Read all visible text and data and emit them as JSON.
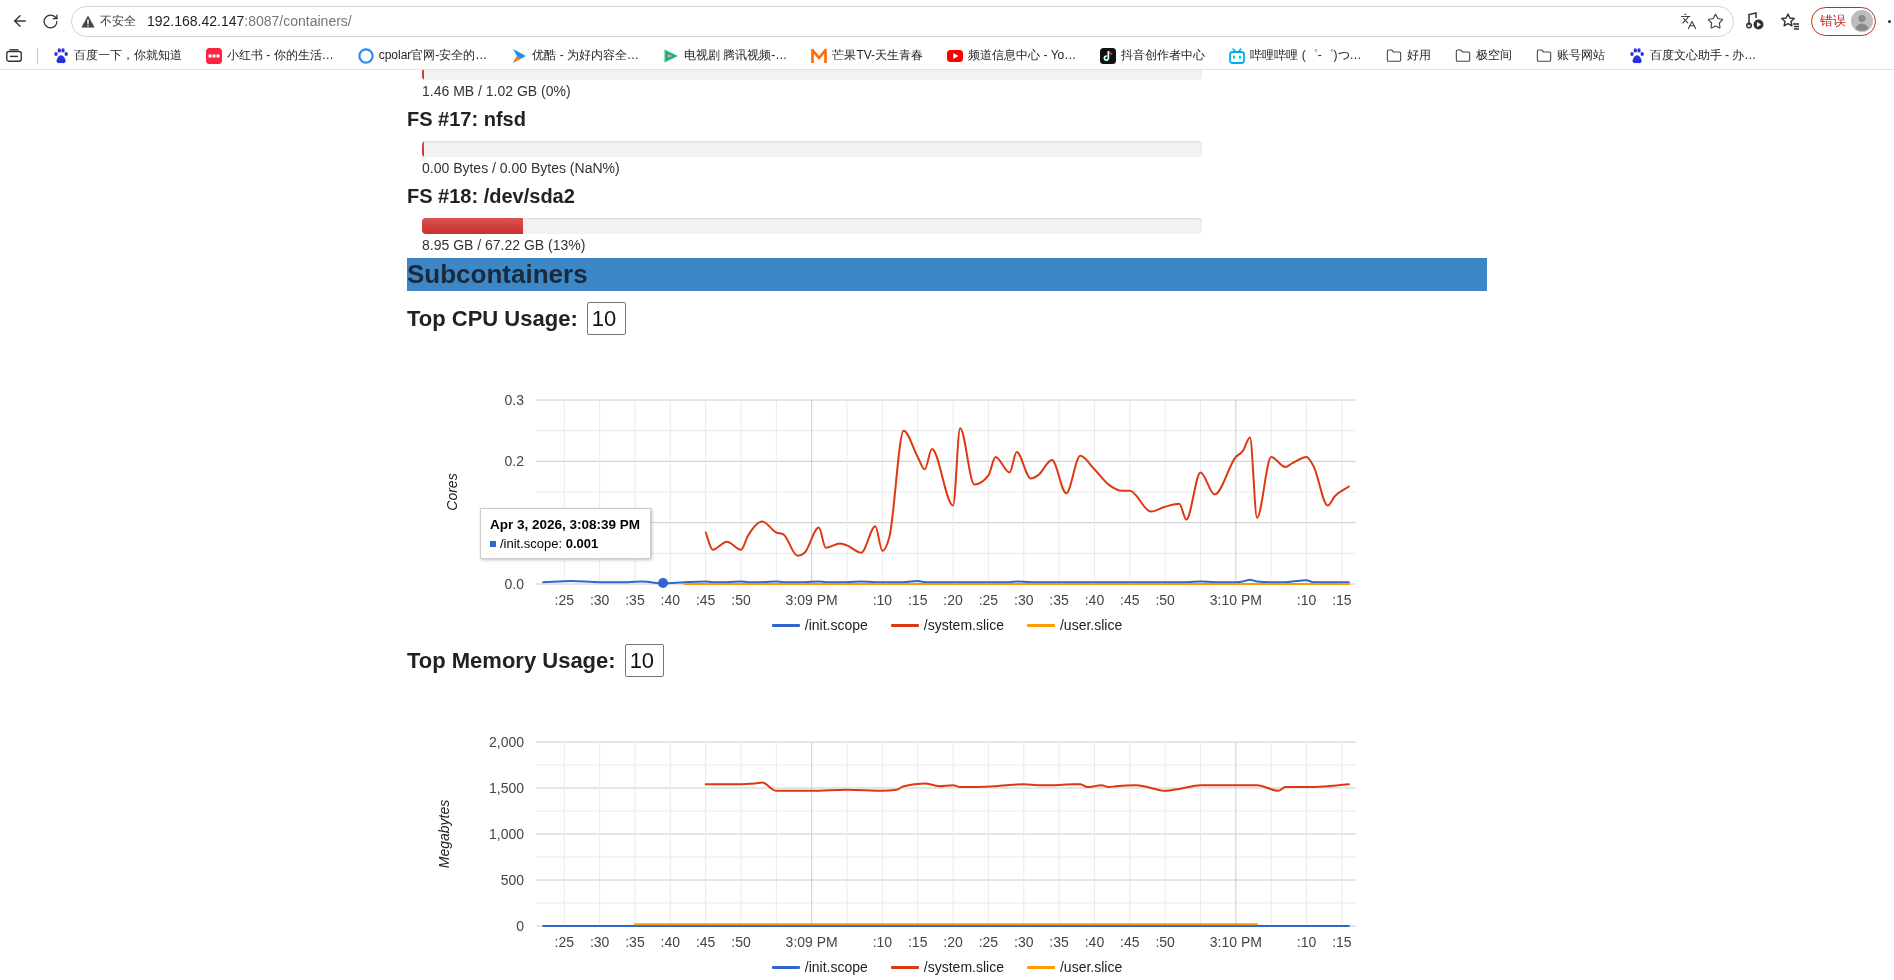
{
  "browser": {
    "address_bar": {
      "security_label": "不安全",
      "host": "192.168.42.147",
      "path": ":8087/containers/"
    },
    "profile_label": "错误",
    "bookmarks": [
      {
        "kind": "paw",
        "title": "百度一下，你就知道"
      },
      {
        "kind": "tile",
        "title": "小红书 - 你的生活…"
      },
      {
        "kind": "ring",
        "title": "cpolar官网-安全的…"
      },
      {
        "kind": "arrow",
        "title": "优酷 - 为好内容全…"
      },
      {
        "kind": "triangle",
        "title": "电视剧 腾讯视频-…"
      },
      {
        "kind": "mlogo",
        "title": "芒果TV-天生青春"
      },
      {
        "kind": "video",
        "title": "频道信息中心 - Yo…"
      },
      {
        "kind": "note",
        "title": "抖音创作者中心"
      },
      {
        "kind": "tv",
        "title": "哔哩哔哩 (゜-゜)つ…"
      },
      {
        "kind": "folder",
        "title": "好用"
      },
      {
        "kind": "folder",
        "title": "极空间"
      },
      {
        "kind": "folder",
        "title": "账号网站"
      },
      {
        "kind": "paw",
        "title": "百度文心助手 - 办…"
      }
    ]
  },
  "filesystems": [
    {
      "usage": "1.46 MB / 1.02 GB (0%)",
      "level": 0
    },
    {
      "name": "FS #17: nfsd",
      "usage": "0.00 Bytes / 0.00 Bytes (NaN%)",
      "level": 0
    },
    {
      "name": "FS #18: /dev/sda2",
      "usage": "8.95 GB / 67.22 GB (13%)",
      "level": 0.13
    }
  ],
  "subcontainers": {
    "title": "Subcontainers",
    "cpu": {
      "label": "Top CPU Usage:",
      "value": "10",
      "chart_data": {
        "type": "line",
        "ylabel": "Cores",
        "grid": true,
        "legend": "bottom",
        "x": [
          "2026-04-03T15:08:22",
          "2026-04-03T15:08:26",
          "2026-04-03T15:08:30",
          "2026-04-03T15:08:34",
          "2026-04-03T15:08:36",
          "2026-04-03T15:08:39",
          "2026-04-03T15:08:42",
          "2026-04-03T15:08:45",
          "2026-04-03T15:08:46",
          "2026-04-03T15:08:48",
          "2026-04-03T15:08:50",
          "2026-04-03T15:08:51",
          "2026-04-03T15:08:53",
          "2026-04-03T15:08:55",
          "2026-04-03T15:08:56",
          "2026-04-03T15:08:58",
          "2026-04-03T15:08:59",
          "2026-04-03T15:09:01",
          "2026-04-03T15:09:02",
          "2026-04-03T15:09:04",
          "2026-04-03T15:09:05",
          "2026-04-03T15:09:07",
          "2026-04-03T15:09:09",
          "2026-04-03T15:09:10",
          "2026-04-03T15:09:11",
          "2026-04-03T15:09:13",
          "2026-04-03T15:09:15",
          "2026-04-03T15:09:16",
          "2026-04-03T15:09:17",
          "2026-04-03T15:09:20",
          "2026-04-03T15:09:21",
          "2026-04-03T15:09:23",
          "2026-04-03T15:09:25",
          "2026-04-03T15:09:26",
          "2026-04-03T15:09:28",
          "2026-04-03T15:09:29",
          "2026-04-03T15:09:31",
          "2026-04-03T15:09:32",
          "2026-04-03T15:09:34",
          "2026-04-03T15:09:36",
          "2026-04-03T15:09:38",
          "2026-04-03T15:09:40",
          "2026-04-03T15:09:42",
          "2026-04-03T15:09:44",
          "2026-04-03T15:09:45",
          "2026-04-03T15:09:48",
          "2026-04-03T15:09:50",
          "2026-04-03T15:09:52",
          "2026-04-03T15:09:53",
          "2026-04-03T15:09:55",
          "2026-04-03T15:09:57",
          "2026-04-03T15:10:00",
          "2026-04-03T15:10:01",
          "2026-04-03T15:10:02",
          "2026-04-03T15:10:03",
          "2026-04-03T15:10:05",
          "2026-04-03T15:10:07",
          "2026-04-03T15:10:08",
          "2026-04-03T15:10:10",
          "2026-04-03T15:10:11",
          "2026-04-03T15:10:13",
          "2026-04-03T15:10:14",
          "2026-04-03T15:10:16"
        ],
        "series": [
          {
            "name": "/init.scope",
            "color": "#3366cc",
            "values": [
              0.003,
              0.005,
              0.003,
              0.003,
              0.004,
              0.001,
              0.003,
              0.004,
              0.003,
              0.003,
              0.004,
              0.003,
              0.003,
              0.004,
              0.003,
              0.003,
              0.003,
              0.004,
              0.003,
              0.003,
              0.003,
              0.004,
              0.003,
              0.003,
              0.003,
              0.003,
              0.005,
              0.003,
              0.003,
              0.003,
              0.003,
              0.003,
              0.003,
              0.003,
              0.003,
              0.004,
              0.003,
              0.003,
              0.003,
              0.003,
              0.003,
              0.003,
              0.003,
              0.003,
              0.003,
              0.003,
              0.003,
              0.003,
              0.003,
              0.004,
              0.003,
              0.003,
              0.004,
              0.007,
              0.004,
              0.003,
              0.003,
              0.004,
              0.006,
              0.003,
              0.003,
              0.003,
              0.003
            ]
          },
          {
            "name": "/system.slice",
            "color": "#dc3912",
            "values": [
              null,
              null,
              null,
              null,
              null,
              null,
              null,
              0.084,
              0.056,
              0.069,
              0.056,
              0.079,
              0.102,
              0.084,
              0.081,
              0.046,
              0.051,
              0.092,
              0.059,
              0.066,
              0.063,
              0.051,
              0.094,
              0.054,
              0.077,
              0.25,
              0.207,
              0.187,
              0.22,
              0.128,
              0.254,
              0.162,
              0.177,
              0.207,
              0.182,
              0.215,
              0.172,
              0.177,
              0.202,
              0.148,
              0.209,
              0.187,
              0.162,
              0.152,
              0.152,
              0.118,
              0.126,
              0.131,
              0.105,
              0.182,
              0.146,
              0.207,
              0.217,
              0.239,
              0.108,
              0.207,
              0.191,
              0.197,
              0.207,
              0.192,
              0.128,
              0.143,
              0.159
            ]
          },
          {
            "name": "/user.slice",
            "color": "#ff9900",
            "values": [
              null,
              null,
              null,
              null,
              null,
              null,
              0,
              0,
              0,
              0,
              0,
              0,
              0,
              0,
              0,
              0,
              0,
              0,
              0,
              0,
              0,
              0,
              0,
              0,
              0,
              0,
              0,
              0,
              0,
              0,
              0,
              0,
              0,
              0,
              0,
              0,
              0,
              0,
              0,
              0,
              0,
              0,
              0,
              0,
              0,
              0,
              0,
              0,
              0,
              0,
              0,
              0,
              0,
              0,
              0,
              0,
              0,
              0,
              0,
              0,
              0,
              0,
              0
            ]
          }
        ],
        "xlim": [
          "2026-04-03T15:08:21",
          "2026-04-03T15:10:17"
        ],
        "ylim": [
          0,
          0.3
        ],
        "xticks": [
          {
            "value": "2026-04-03T15:08:25",
            "label": ":25"
          },
          {
            "value": "2026-04-03T15:08:30",
            "label": ":30"
          },
          {
            "value": "2026-04-03T15:08:35",
            "label": ":35"
          },
          {
            "value": "2026-04-03T15:08:40",
            "label": ":40"
          },
          {
            "value": "2026-04-03T15:08:45",
            "label": ":45"
          },
          {
            "value": "2026-04-03T15:08:50",
            "label": ":50"
          },
          {
            "value": "2026-04-03T15:09:00",
            "label": "3:09 PM"
          },
          {
            "value": "2026-04-03T15:09:10",
            "label": ":10"
          },
          {
            "value": "2026-04-03T15:09:15",
            "label": ":15"
          },
          {
            "value": "2026-04-03T15:09:20",
            "label": ":20"
          },
          {
            "value": "2026-04-03T15:09:25",
            "label": ":25"
          },
          {
            "value": "2026-04-03T15:09:30",
            "label": ":30"
          },
          {
            "value": "2026-04-03T15:09:35",
            "label": ":35"
          },
          {
            "value": "2026-04-03T15:09:40",
            "label": ":40"
          },
          {
            "value": "2026-04-03T15:09:45",
            "label": ":45"
          },
          {
            "value": "2026-04-03T15:09:50",
            "label": ":50"
          },
          {
            "value": "2026-04-03T15:10:00",
            "label": "3:10 PM"
          },
          {
            "value": "2026-04-03T15:10:10",
            "label": ":10"
          },
          {
            "value": "2026-04-03T15:10:15",
            "label": ":15"
          }
        ],
        "yticks": [
          {
            "value": 0,
            "label": "0.0"
          },
          {
            "value": 0.2,
            "label": "0.2"
          },
          {
            "value": 0.3,
            "label": "0.3"
          }
        ]
      },
      "tooltip": {
        "title": "Apr 3, 2026, 3:08:39 PM",
        "rows": [
          {
            "text": "/init.scope: **0.001**",
            "color": "#3366cc"
          }
        ]
      }
    },
    "memory": {
      "label": "Top Memory Usage:",
      "value": "10",
      "chart_data": {
        "type": "line",
        "ylabel": "Megabytes",
        "grid": true,
        "legend": "bottom",
        "x": [
          "2026-04-03T15:08:22",
          "2026-04-03T15:08:35",
          "2026-04-03T15:08:40",
          "2026-04-03T15:08:45",
          "2026-04-03T15:08:48",
          "2026-04-03T15:08:52",
          "2026-04-03T15:08:53",
          "2026-04-03T15:08:55",
          "2026-04-03T15:09:00",
          "2026-04-03T15:09:05",
          "2026-04-03T15:09:10",
          "2026-04-03T15:09:12",
          "2026-04-03T15:09:13",
          "2026-04-03T15:09:16",
          "2026-04-03T15:09:18",
          "2026-04-03T15:09:20",
          "2026-04-03T15:09:21",
          "2026-04-03T15:09:26",
          "2026-04-03T15:09:30",
          "2026-04-03T15:09:32",
          "2026-04-03T15:09:34",
          "2026-04-03T15:09:37",
          "2026-04-03T15:09:38",
          "2026-04-03T15:09:39",
          "2026-04-03T15:09:41",
          "2026-04-03T15:09:42",
          "2026-04-03T15:09:43",
          "2026-04-03T15:09:46",
          "2026-04-03T15:09:48",
          "2026-04-03T15:09:50",
          "2026-04-03T15:09:52",
          "2026-04-03T15:09:55",
          "2026-04-03T15:10:00",
          "2026-04-03T15:10:03",
          "2026-04-03T15:10:06",
          "2026-04-03T15:10:07",
          "2026-04-03T15:10:10",
          "2026-04-03T15:10:13",
          "2026-04-03T15:10:16"
        ],
        "series": [
          {
            "name": "/init.scope",
            "color": "#3366cc",
            "values": [
              0,
              0,
              0,
              0,
              0,
              0,
              0,
              0,
              0,
              0,
              0,
              0,
              0,
              0,
              0,
              0,
              0,
              0,
              0,
              0,
              0,
              0,
              0,
              0,
              0,
              0,
              0,
              0,
              0,
              0,
              0,
              0,
              0,
              0,
              0,
              0,
              0,
              0,
              0
            ]
          },
          {
            "name": "/system.slice",
            "color": "#dc3912",
            "values": [
              null,
              null,
              null,
              1540,
              1540,
              1550,
              1560,
              1470,
              1470,
              1480,
              1470,
              1480,
              1520,
              1550,
              1520,
              1530,
              1510,
              1520,
              1540,
              1530,
              1530,
              1540,
              1540,
              1510,
              1530,
              1510,
              1520,
              1530,
              1500,
              1470,
              1490,
              1530,
              1530,
              1530,
              1470,
              1510,
              1510,
              1520,
              1540
            ]
          },
          {
            "name": "/user.slice",
            "color": "#ff9900",
            "values": [
              null,
              20,
              20,
              20,
              20,
              20,
              20,
              20,
              20,
              20,
              20,
              20,
              20,
              20,
              20,
              20,
              20,
              20,
              20,
              20,
              20,
              20,
              20,
              20,
              20,
              20,
              20,
              20,
              20,
              20,
              20,
              20,
              20,
              20,
              null,
              null,
              null,
              null,
              null
            ]
          }
        ],
        "xlim": [
          "2026-04-03T15:08:21",
          "2026-04-03T15:10:17"
        ],
        "ylim": [
          0,
          2000
        ],
        "xticks": [
          {
            "value": "2026-04-03T15:08:25",
            "label": ":25"
          },
          {
            "value": "2026-04-03T15:08:30",
            "label": ":30"
          },
          {
            "value": "2026-04-03T15:08:35",
            "label": ":35"
          },
          {
            "value": "2026-04-03T15:08:40",
            "label": ":40"
          },
          {
            "value": "2026-04-03T15:08:45",
            "label": ":45"
          },
          {
            "value": "2026-04-03T15:08:50",
            "label": ":50"
          },
          {
            "value": "2026-04-03T15:09:00",
            "label": "3:09 PM"
          },
          {
            "value": "2026-04-03T15:09:10",
            "label": ":10"
          },
          {
            "value": "2026-04-03T15:09:15",
            "label": ":15"
          },
          {
            "value": "2026-04-03T15:09:20",
            "label": ":20"
          },
          {
            "value": "2026-04-03T15:09:25",
            "label": ":25"
          },
          {
            "value": "2026-04-03T15:09:30",
            "label": ":30"
          },
          {
            "value": "2026-04-03T15:09:35",
            "label": ":35"
          },
          {
            "value": "2026-04-03T15:09:40",
            "label": ":40"
          },
          {
            "value": "2026-04-03T15:09:45",
            "label": ":45"
          },
          {
            "value": "2026-04-03T15:09:50",
            "label": ":50"
          },
          {
            "value": "2026-04-03T15:10:00",
            "label": "3:10 PM"
          },
          {
            "value": "2026-04-03T15:10:10",
            "label": ":10"
          },
          {
            "value": "2026-04-03T15:10:15",
            "label": ":15"
          }
        ],
        "yticks": [
          {
            "value": 0,
            "label": "0"
          },
          {
            "value": 500,
            "label": "500"
          },
          {
            "value": 1000,
            "label": "1,000"
          },
          {
            "value": 1500,
            "label": "1,500"
          },
          {
            "value": 2000,
            "label": "2,000"
          }
        ]
      }
    }
  }
}
